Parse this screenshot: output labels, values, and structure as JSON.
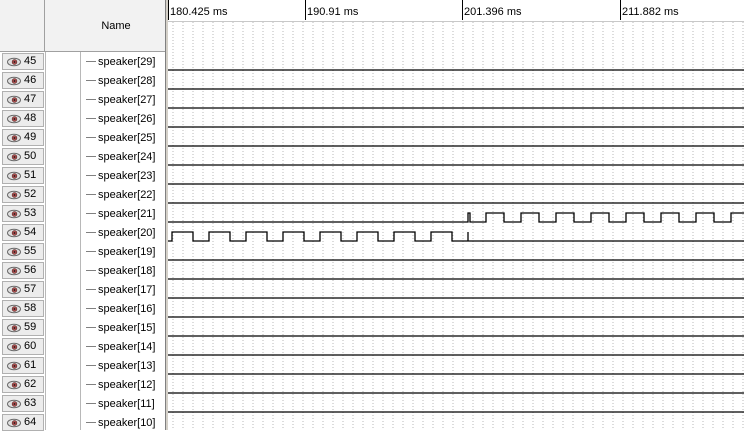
{
  "header": {
    "name_column": "Name"
  },
  "timeline": {
    "labels": [
      "180.425 ms",
      "190.91 ms",
      "201.396 ms",
      "211.882 ms"
    ]
  },
  "signals": [
    {
      "index": "45",
      "name": "speaker[29]"
    },
    {
      "index": "46",
      "name": "speaker[28]"
    },
    {
      "index": "47",
      "name": "speaker[27]"
    },
    {
      "index": "48",
      "name": "speaker[26]"
    },
    {
      "index": "49",
      "name": "speaker[25]"
    },
    {
      "index": "50",
      "name": "speaker[24]"
    },
    {
      "index": "51",
      "name": "speaker[23]"
    },
    {
      "index": "52",
      "name": "speaker[22]"
    },
    {
      "index": "53",
      "name": "speaker[21]"
    },
    {
      "index": "54",
      "name": "speaker[20]"
    },
    {
      "index": "55",
      "name": "speaker[19]"
    },
    {
      "index": "56",
      "name": "speaker[18]"
    },
    {
      "index": "57",
      "name": "speaker[17]"
    },
    {
      "index": "58",
      "name": "speaker[16]"
    },
    {
      "index": "59",
      "name": "speaker[15]"
    },
    {
      "index": "60",
      "name": "speaker[14]"
    },
    {
      "index": "61",
      "name": "speaker[13]"
    },
    {
      "index": "62",
      "name": "speaker[12]"
    },
    {
      "index": "63",
      "name": "speaker[11]"
    },
    {
      "index": "64",
      "name": "speaker[10]"
    }
  ],
  "colors": {
    "header_bg": "#f2f2f2",
    "grid_dot": "#b8b8b8",
    "wave": "#000000"
  }
}
